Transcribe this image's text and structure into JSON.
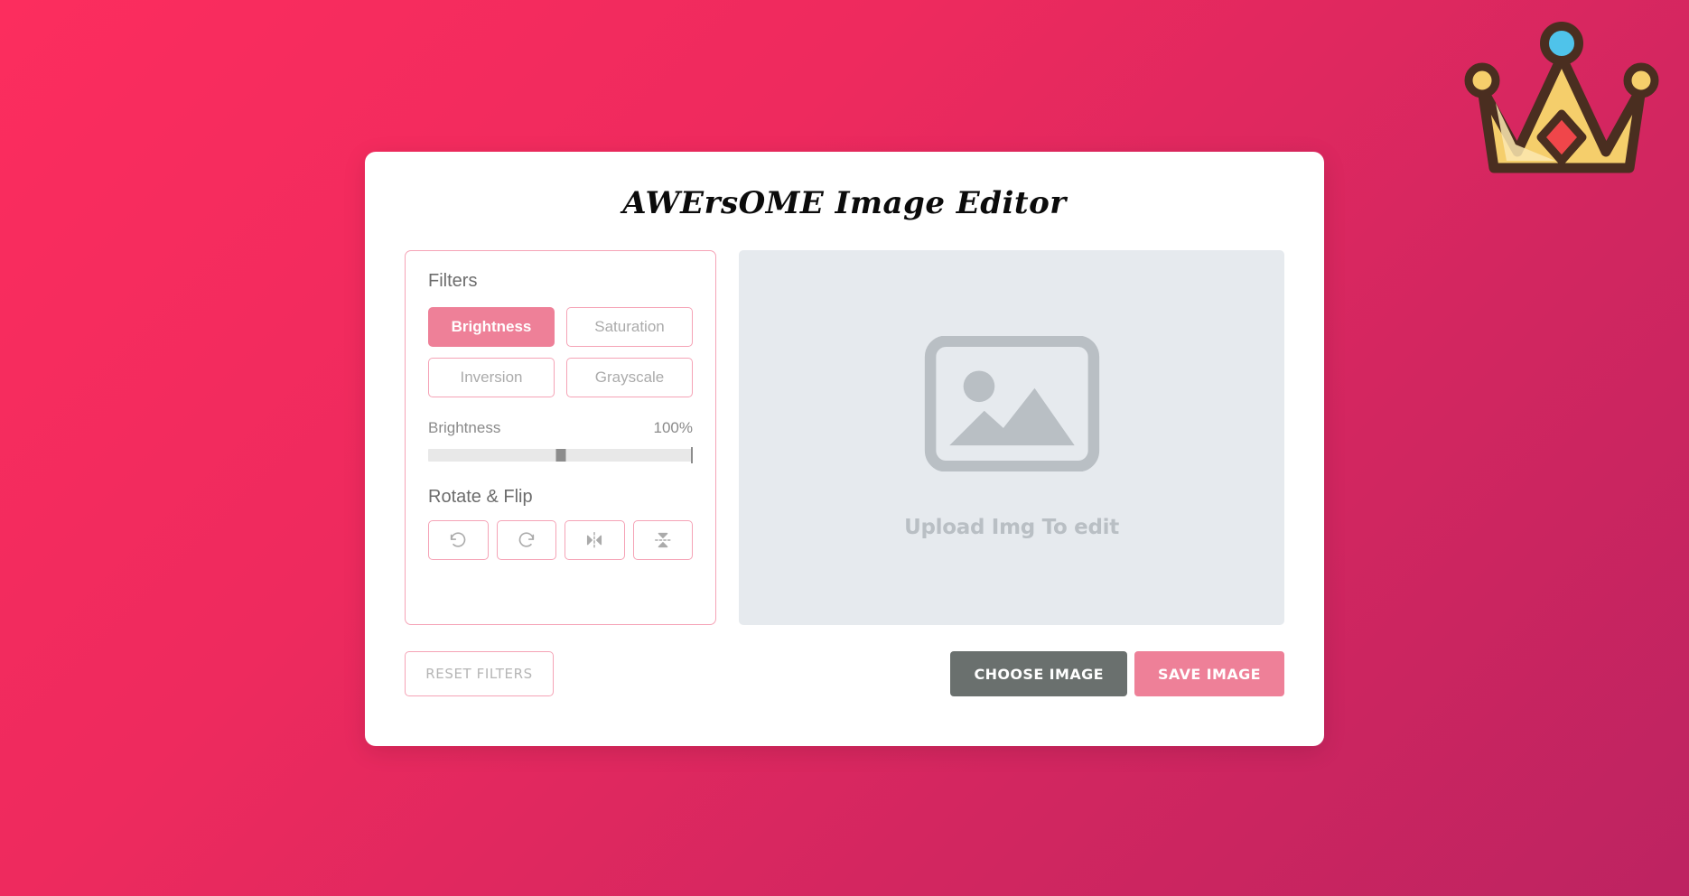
{
  "theme": {
    "bg_gradient_start": "#FC2D5E",
    "bg_gradient_end": "#BD2361",
    "accent_pink": "#EE8098",
    "border_pink": "#F5A3B6",
    "dark_gray": "#6A706E",
    "preview_bg": "#E6EAEE",
    "crown_gold": "#F5CE6B",
    "crown_outline": "#4A2E20",
    "crown_gem_blue": "#4FC3EA",
    "crown_gem_red": "#F0464A"
  },
  "decoration": {
    "crown_icon": "crown-icon"
  },
  "app": {
    "title": "AWErsOME Image Editor"
  },
  "filters": {
    "heading": "Filters",
    "buttons": [
      {
        "label": "Brightness",
        "active": true
      },
      {
        "label": "Saturation",
        "active": false
      },
      {
        "label": "Inversion",
        "active": false
      },
      {
        "label": "Grayscale",
        "active": false
      }
    ],
    "slider": {
      "label": "Brightness",
      "value_text": "100%",
      "value": 100,
      "min": 0,
      "max": 200,
      "thumb_percent": 50
    }
  },
  "rotate_flip": {
    "heading": "Rotate & Flip",
    "buttons": [
      {
        "icon": "rotate-left-icon",
        "label": "Rotate Left"
      },
      {
        "icon": "rotate-right-icon",
        "label": "Rotate Right"
      },
      {
        "icon": "flip-horizontal-icon",
        "label": "Flip Horizontal"
      },
      {
        "icon": "flip-vertical-icon",
        "label": "Flip Vertical"
      }
    ]
  },
  "preview": {
    "placeholder_icon": "image-placeholder-icon",
    "placeholder_text": "Upload Img To edit"
  },
  "controls": {
    "reset_label": "RESET FILTERS",
    "choose_label": "CHOOSE IMAGE",
    "save_label": "SAVE IMAGE"
  }
}
